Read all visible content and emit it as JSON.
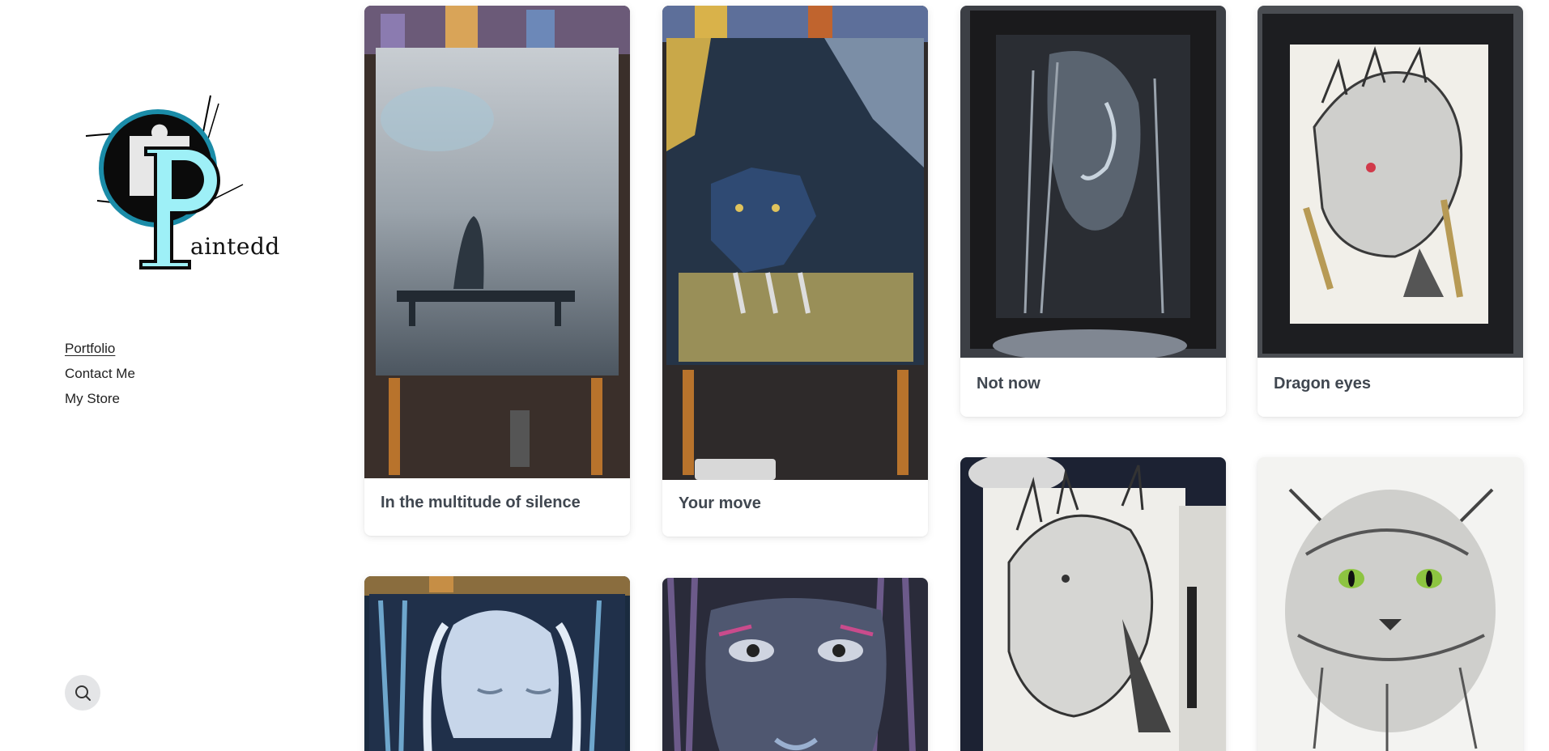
{
  "site": {
    "logo_text": "aintedd",
    "logo_letter": "P"
  },
  "nav": {
    "items": [
      {
        "label": "Portfolio",
        "active": true
      },
      {
        "label": "Contact Me",
        "active": false
      },
      {
        "label": "My Store",
        "active": false
      }
    ]
  },
  "search": {
    "icon": "search-icon"
  },
  "gallery": {
    "items": [
      {
        "title": "In the multitude of silence",
        "image": "girl-on-bench-painting"
      },
      {
        "title": "Your move",
        "image": "wolf-painting"
      },
      {
        "title": "Not now",
        "image": "woman-profile-painting"
      },
      {
        "title": "Dragon eyes",
        "image": "dragon-drawing"
      },
      {
        "title": "",
        "image": "dragon-sketch"
      },
      {
        "title": "",
        "image": "cat-drawing"
      },
      {
        "title": "",
        "image": "woman-closed-eyes-painting"
      },
      {
        "title": "",
        "image": "face-eyes-painting"
      }
    ]
  },
  "colors": {
    "background": "#ffffff",
    "title_text": "#404750",
    "search_bg": "#e4e5e7",
    "logo_cyan": "#8fe3f0"
  }
}
